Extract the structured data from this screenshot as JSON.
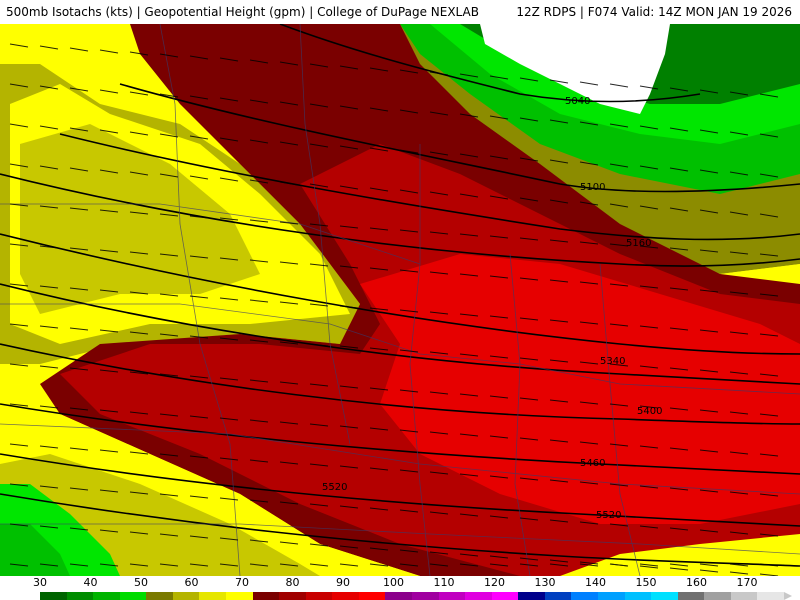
{
  "header": {
    "left_text": "500mb Isotachs (kts) | Geopotential Height (gpm) | College of DuPage NEXLAB",
    "right_text": "12Z RDPS | F074 Valid: 14Z MON JAN 19 2026"
  },
  "colorbar": {
    "labels": [
      "30",
      "40",
      "50",
      "60",
      "70",
      "80",
      "90",
      "100",
      "110",
      "120",
      "130",
      "140",
      "150",
      "160",
      "170"
    ],
    "colors": [
      "#006400",
      "#008c00",
      "#00b400",
      "#00dc00",
      "#7a7a00",
      "#b4b400",
      "#e6e600",
      "#ffff00",
      "#7a0000",
      "#a00000",
      "#c80000",
      "#e60000",
      "#ff0000",
      "#8b008b",
      "#a000a0",
      "#c000c0",
      "#e000e0",
      "#ff00ff",
      "#00008b",
      "#0040c0",
      "#0080ff",
      "#00a0ff",
      "#00c0ff",
      "#00e0ff",
      "#707070",
      "#a0a0a0",
      "#c8c8c8",
      "#e6e6e6"
    ]
  },
  "contour_labels": [
    "5040",
    "5100",
    "5160",
    "5340",
    "5400",
    "5460",
    "5520",
    "5520"
  ],
  "colors": {
    "calm": "#ffffff",
    "green_dark": "#008000",
    "green_mid": "#00c000",
    "green_bright": "#00e600",
    "olive": "#8c8c00",
    "yellow_dark": "#c8c800",
    "yellow": "#ffff00",
    "red_dark": "#7a0000",
    "red_mid": "#b40000",
    "red": "#e60000"
  }
}
